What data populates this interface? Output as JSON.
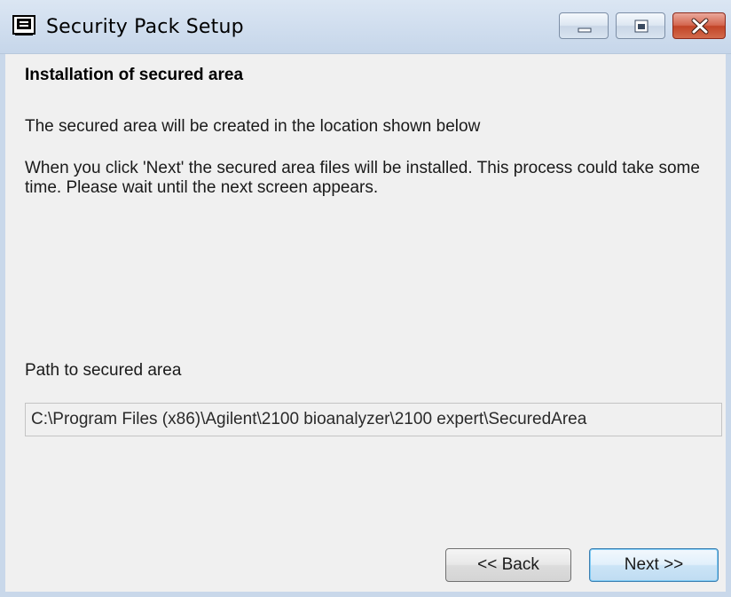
{
  "window": {
    "title": "Security Pack Setup",
    "icon": "app-window-icon",
    "controls": {
      "minimize_icon": "minimize-icon",
      "maximize_icon": "maximize-icon",
      "close_icon": "close-icon",
      "close_color": "#c9452a"
    }
  },
  "content": {
    "heading": "Installation of secured area",
    "paragraph1": "The secured area will be created in the location shown below",
    "paragraph2": "When you click 'Next' the secured area files will be installed. This process could take some time. Please wait until the next screen appears.",
    "path_label": "Path to secured area",
    "path_value": "C:\\Program Files (x86)\\Agilent\\2100 bioanalyzer\\2100 expert\\SecuredArea"
  },
  "buttons": {
    "back_label": "<< Back",
    "next_label": "Next >>"
  },
  "colors": {
    "titlebar": "#c6d6ea",
    "dialog_background": "#f0f0f0",
    "default_button_border": "#3c7fb1"
  }
}
